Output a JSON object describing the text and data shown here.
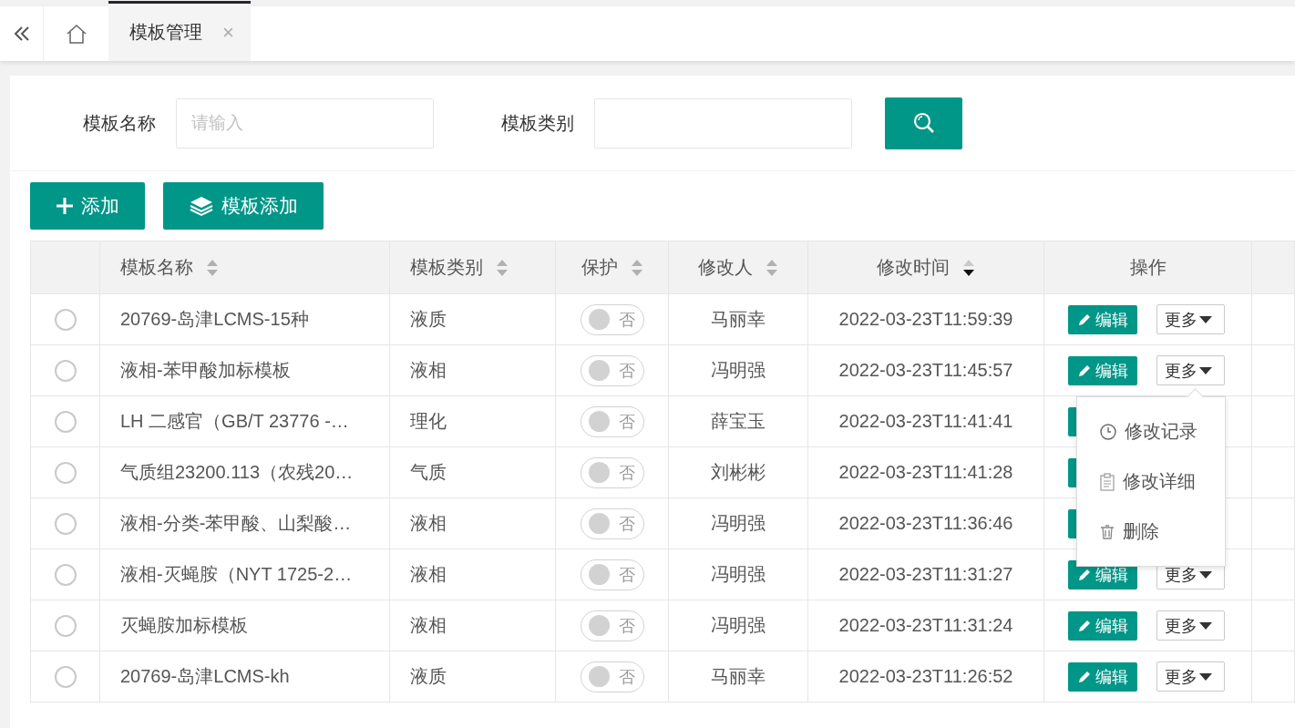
{
  "tabbar": {
    "tabs": [
      {
        "label": "模板管理",
        "selected": true,
        "close": "×"
      }
    ]
  },
  "search": {
    "fields": [
      {
        "label": "模板名称",
        "placeholder": "请输入"
      },
      {
        "label": "模板类别"
      }
    ]
  },
  "toolbar": {
    "buttons": [
      {
        "kind": "add",
        "label": "添加"
      },
      {
        "kind": "layers",
        "label": "模板添加"
      }
    ]
  },
  "table": {
    "columns": [
      {},
      {
        "label": "模板名称",
        "sorted_desc": false
      },
      {
        "label": "模板类别",
        "sorted_desc": false
      },
      {
        "label": "保护",
        "sorted_desc": false
      },
      {
        "label": "修改人",
        "sorted_desc": false
      },
      {
        "label": "修改时间",
        "sorted_desc": true
      },
      {
        "label": "操作"
      },
      {}
    ],
    "rows": [
      {
        "selected": false,
        "name": "20769-岛津LCMS-15种",
        "category": "液质",
        "protected": false,
        "protect_label": "否",
        "modifier": "马丽幸",
        "time": "2022-03-23T11:59:39",
        "edit": "编辑",
        "more": "更多",
        "menu_open": false
      },
      {
        "selected": false,
        "name": "液相-苯甲酸加标模板",
        "category": "液相",
        "protected": false,
        "protect_label": "否",
        "modifier": "冯明强",
        "time": "2022-03-23T11:45:57",
        "edit": "编辑",
        "more": "更多",
        "menu_open": true
      },
      {
        "selected": false,
        "name": "LH 二感官（GB/T 23776 -…",
        "category": "理化",
        "protected": false,
        "protect_label": "否",
        "modifier": "薛宝玉",
        "time": "2022-03-23T11:41:41",
        "menu_open": false
      },
      {
        "selected": false,
        "name": "气质组23200.113（农残20…",
        "category": "气质",
        "protected": false,
        "protect_label": "否",
        "modifier": "刘彬彬",
        "time": "2022-03-23T11:41:28",
        "menu_open": false
      },
      {
        "selected": false,
        "name": "液相-分类-苯甲酸、山梨酸…",
        "category": "液相",
        "protected": false,
        "protect_label": "否",
        "modifier": "冯明强",
        "time": "2022-03-23T11:36:46",
        "menu_open": false
      },
      {
        "selected": false,
        "name": "液相-灭蝇胺（NYT 1725-2…",
        "category": "液相",
        "protected": false,
        "protect_label": "否",
        "modifier": "冯明强",
        "time": "2022-03-23T11:31:27",
        "edit": "编辑",
        "more": "更多",
        "menu_open": false
      },
      {
        "selected": false,
        "name": "灭蝇胺加标模板",
        "category": "液相",
        "protected": false,
        "protect_label": "否",
        "modifier": "冯明强",
        "time": "2022-03-23T11:31:24",
        "edit": "编辑",
        "more": "更多",
        "menu_open": false
      },
      {
        "selected": false,
        "name": "20769-岛津LCMS-kh",
        "category": "液质",
        "protected": false,
        "protect_label": "否",
        "modifier": "马丽幸",
        "time": "2022-03-23T11:26:52",
        "edit": "编辑",
        "more": "更多",
        "menu_open": false
      }
    ],
    "menu": [
      {
        "kind": "history",
        "label": "修改记录"
      },
      {
        "kind": "details",
        "label": "修改详细"
      },
      {
        "kind": "delete",
        "label": "删除"
      }
    ]
  }
}
